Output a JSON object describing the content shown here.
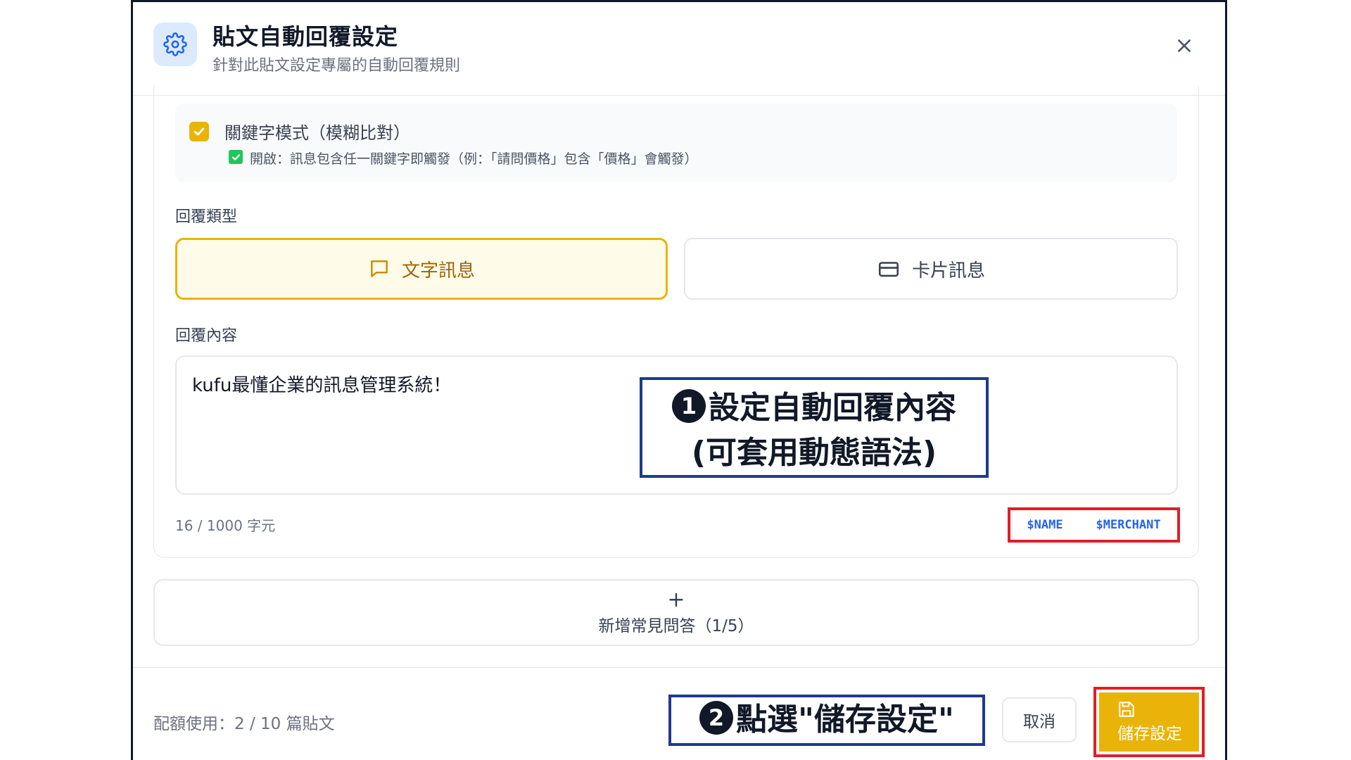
{
  "header": {
    "title": "貼文自動回覆設定",
    "subtitle": "針對此貼文設定專屬的自動回覆規則"
  },
  "keyword_mode": {
    "label": "關鍵字模式（模糊比對）",
    "hint": "開啟：訊息包含任一關鍵字即觸發（例：「請問價格」包含「價格」會觸發）",
    "checked": true
  },
  "reply_type": {
    "label": "回覆類型",
    "options": [
      {
        "label": "文字訊息",
        "icon": "chat-bubble-icon",
        "selected": true
      },
      {
        "label": "卡片訊息",
        "icon": "card-icon",
        "selected": false
      }
    ]
  },
  "reply_content": {
    "label": "回覆內容",
    "value": "kufu最懂企業的訊息管理系統！",
    "char_count": "16 / 1000 字元",
    "variables": [
      "$NAME",
      "$MERCHANT"
    ]
  },
  "add_faq": {
    "plus": "+",
    "label": "新增常見問答（1/5）"
  },
  "footer": {
    "quota": "配額使用：2 / 10 篇貼文",
    "cancel_label": "取消",
    "save_label": "儲存設定"
  },
  "annotations": {
    "step1_number": "1",
    "step1_line1": "設定自動回覆內容",
    "step1_line2": "(可套用動態語法)",
    "step2_number": "2",
    "step2_text": "點選\"儲存設定\""
  },
  "colors": {
    "accent_yellow": "#eab308",
    "annotation_red": "#e11d28",
    "annotation_navy": "#1e3a8a",
    "variable_blue": "#2563eb",
    "header_icon_bg": "#dbeafe"
  }
}
